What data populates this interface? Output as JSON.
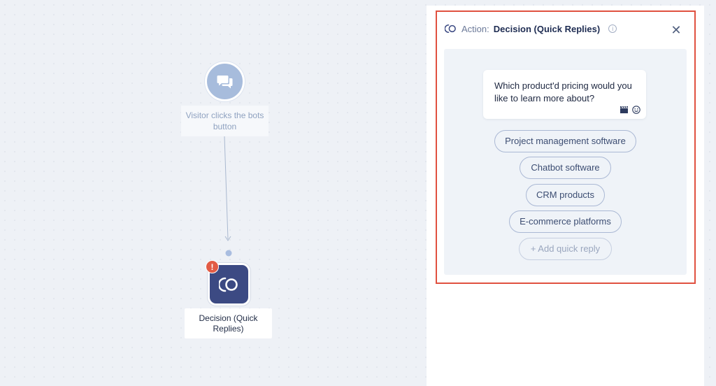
{
  "flow": {
    "trigger": {
      "icon": "chat-bubbles-icon",
      "label": "Visitor clicks the bots button"
    },
    "decision": {
      "icon": "quick-replies-icon",
      "badge": "!",
      "label": "Decision (Quick Replies)"
    }
  },
  "panel": {
    "header_icon": "quick-replies-icon",
    "prefix": "Action:",
    "title": "Decision (Quick Replies)",
    "info_icon": "i",
    "close_icon": "✕",
    "message": "Which product'd pricing would you like to learn more about?",
    "message_tools": [
      "clapperboard-icon",
      "smile-icon"
    ],
    "quick_replies": [
      "Project management software",
      "Chatbot software",
      "CRM products",
      "E-commerce platforms"
    ],
    "add_reply": "+ Add quick reply"
  },
  "colors": {
    "accent": "#3c4a83",
    "highlight": "#e05140",
    "error": "#e25b45",
    "trigger": "#a7bcdc"
  }
}
